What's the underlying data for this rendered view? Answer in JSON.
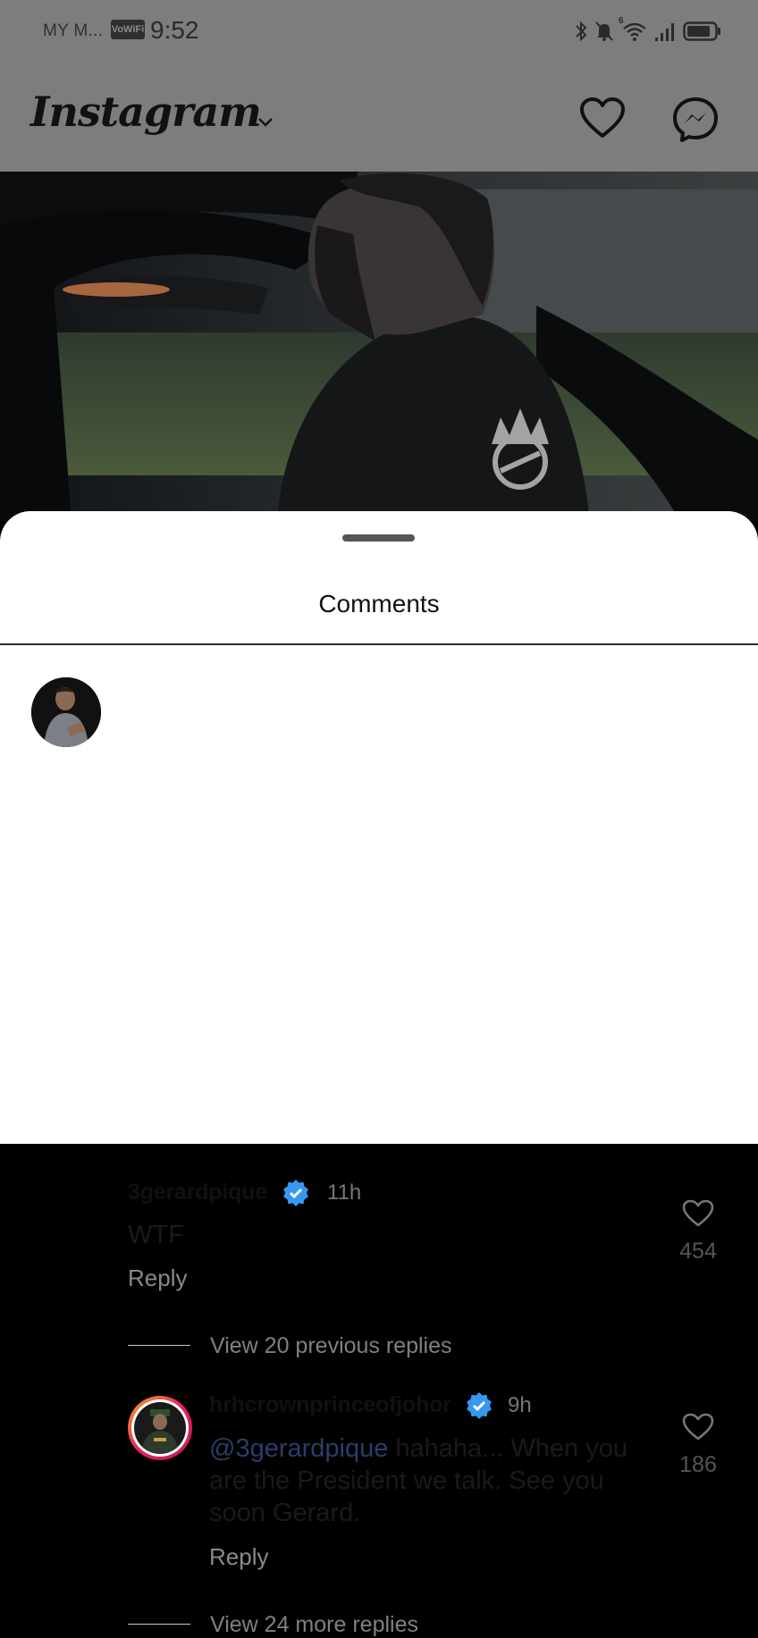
{
  "status_bar": {
    "carrier": "MY M...",
    "vowifi": "VoWiFi",
    "time": "9:52",
    "network_badge": "6"
  },
  "header": {
    "logo": "Instagram",
    "icons": [
      "chevron-down-icon",
      "heart-icon",
      "messenger-icon"
    ]
  },
  "sheet": {
    "title": "Comments"
  },
  "comments": [
    {
      "username": "3gerardpique",
      "verified": true,
      "time": "11h",
      "text": "WTF",
      "reply_label": "Reply",
      "likes": "454"
    }
  ],
  "view_previous": "View 20 previous replies",
  "replies": [
    {
      "username": "hrhcrownprinceofjohor",
      "verified": true,
      "time": "9h",
      "mention": "@3gerardpique",
      "text": " hahaha... When you are the President we talk. See you soon Gerard.",
      "reply_label": "Reply",
      "likes": "186"
    }
  ],
  "view_more": "View 24 more replies",
  "colors": {
    "verified_blue": "#3897f0",
    "mention": "#2b3d6b",
    "dim_overlay": "#7d7d7d"
  }
}
